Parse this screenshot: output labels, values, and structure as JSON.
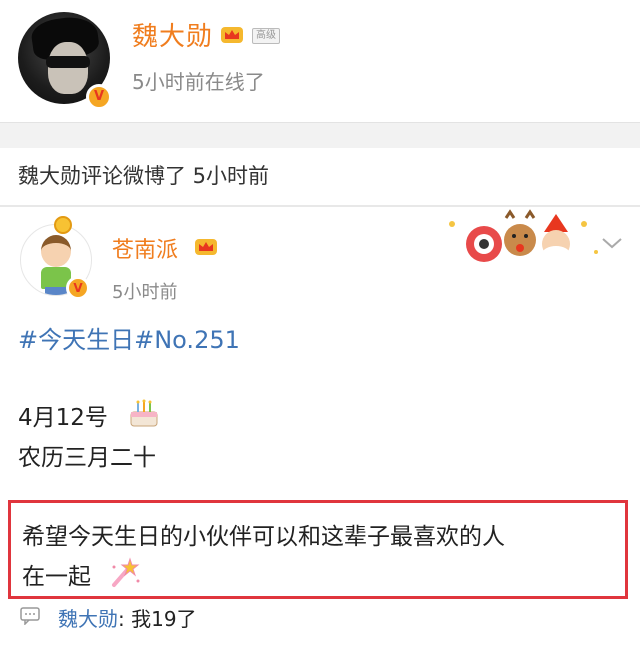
{
  "profile": {
    "name": "魏大勋",
    "badge_tag": "高级",
    "status": "5小时前在线了",
    "verified_icon": "v-badge-icon",
    "crown_icon": "crown-icon"
  },
  "activity": {
    "text": "魏大勋评论微博了 5小时前"
  },
  "post": {
    "author": "苍南派",
    "time": "5小时前",
    "hashtag": "#今天生日#",
    "number_tag": "No.251",
    "date": "4月12号",
    "lunar": "农历三月二十",
    "wish_line1": "希望今天生日的小伙伴可以和这辈子最喜欢的人",
    "wish_line2": "在一起"
  },
  "comment": {
    "author": "魏大勋",
    "sep": ": ",
    "text": "我19了"
  },
  "colors": {
    "name_orange": "#f07d1e",
    "link_blue": "#3f74b5",
    "highlight_red": "#e0353d",
    "muted_gray": "#8a8a8a"
  }
}
